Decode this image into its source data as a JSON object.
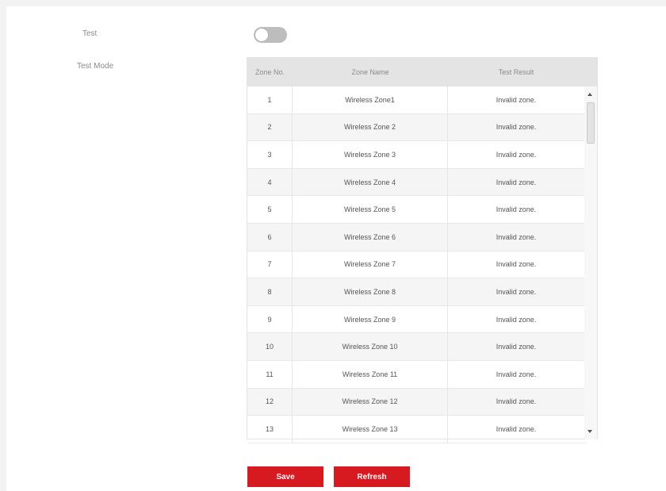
{
  "form": {
    "test_label": "Test",
    "test_mode_label": "Test Mode",
    "test_toggle_on": false
  },
  "table": {
    "headers": [
      "Zone No.",
      "Zone Name",
      "Test Result"
    ],
    "rows": [
      {
        "no": "1",
        "name": "Wireless Zone1",
        "result": "Invalid zone."
      },
      {
        "no": "2",
        "name": "Wireless Zone 2",
        "result": "Invalid zone."
      },
      {
        "no": "3",
        "name": "Wireless Zone 3",
        "result": "Invalid zone."
      },
      {
        "no": "4",
        "name": "Wireless Zone 4",
        "result": "Invalid zone."
      },
      {
        "no": "5",
        "name": "Wireless Zone 5",
        "result": "Invalid zone."
      },
      {
        "no": "6",
        "name": "Wireless Zone 6",
        "result": "Invalid zone."
      },
      {
        "no": "7",
        "name": "Wireless Zone 7",
        "result": "Invalid zone."
      },
      {
        "no": "8",
        "name": "Wireless Zone 8",
        "result": "Invalid zone."
      },
      {
        "no": "9",
        "name": "Wireless Zone 9",
        "result": "Invalid zone."
      },
      {
        "no": "10",
        "name": "Wireless Zone 10",
        "result": "Invalid zone."
      },
      {
        "no": "11",
        "name": "Wireless Zone 11",
        "result": "Invalid zone."
      },
      {
        "no": "12",
        "name": "Wireless Zone 12",
        "result": "Invalid zone."
      },
      {
        "no": "13",
        "name": "Wireless Zone 13",
        "result": "Invalid zone."
      }
    ]
  },
  "buttons": {
    "save": "Save",
    "refresh": "Refresh"
  },
  "colors": {
    "accent": "#d71920",
    "toggle_off": "#bdbdbd",
    "header_bg": "#e4e4e4"
  }
}
